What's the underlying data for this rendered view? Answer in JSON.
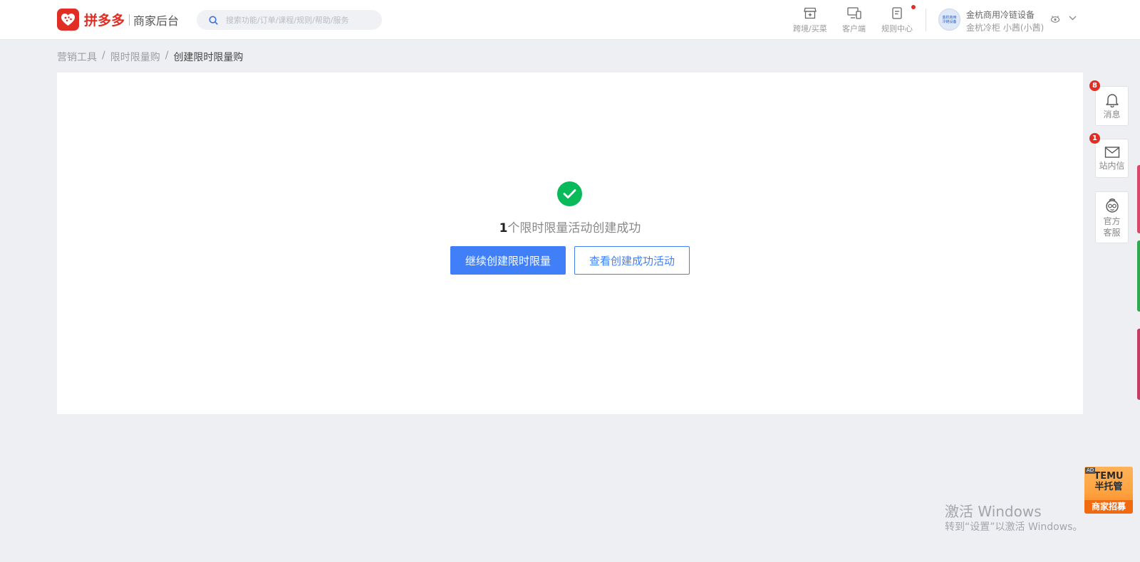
{
  "header": {
    "brand_name": "拼多多",
    "brand_sub": "商家后台",
    "search_placeholder": "搜索功能/订单/课程/规则/帮助/服务",
    "tools": [
      {
        "label": "跨境/买菜",
        "icon": "store-icon"
      },
      {
        "label": "客户端",
        "icon": "desktop-icon"
      },
      {
        "label": "规则中心",
        "icon": "document-icon"
      }
    ],
    "shop_avatar_text": "金杭商用冷链设备",
    "shop_name": "金杭商用冷链设备",
    "shop_user": "金杭冷柜 小茜(小茜)"
  },
  "breadcrumb": [
    "营销工具",
    "限时限量购",
    "创建限时限量购"
  ],
  "result": {
    "count": "1",
    "message": "个限时限量活动创建成功",
    "primary_button": "继续创建限时限量",
    "secondary_button": "查看创建成功活动"
  },
  "float_panel": [
    {
      "label": "消息",
      "badge": "8",
      "icon": "bell-icon"
    },
    {
      "label": "站内信",
      "badge": "1",
      "icon": "mail-icon"
    },
    {
      "label": "官方客服",
      "badge": "",
      "icon": "customer-service-icon"
    }
  ],
  "ad": {
    "tag": "AD",
    "line1": "TEMU",
    "line2": "半托管",
    "line3": "商家招募"
  },
  "watermark": {
    "title": "激活 Windows",
    "subtitle": "转到“设置”以激活 Windows。"
  },
  "colors": {
    "brand_red": "#e02e24",
    "primary_blue": "#417ff9",
    "success_green": "#09ba5b",
    "page_bg": "#eeeff3"
  }
}
